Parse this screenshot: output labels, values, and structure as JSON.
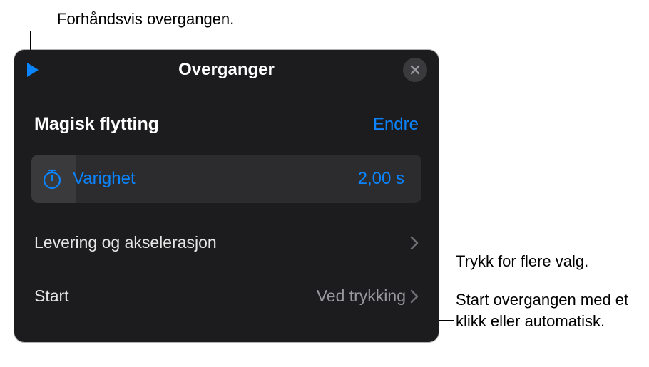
{
  "annotations": {
    "preview": "Forhåndsvis overgangen.",
    "more_options": "Trykk for flere valg.",
    "start_desc": "Start overgangen med et klikk eller automatisk."
  },
  "panel": {
    "title": "Overganger",
    "section_title": "Magisk flytting",
    "change_label": "Endre",
    "duration": {
      "label": "Varighet",
      "value": "2,00 s"
    },
    "delivery": {
      "label": "Levering og akselerasjon"
    },
    "start": {
      "label": "Start",
      "value": "Ved trykking"
    }
  },
  "colors": {
    "accent": "#0a84ff",
    "panel_bg": "#1c1c1e",
    "row_bg": "#2c2c2e",
    "secondary_text": "#98989d"
  }
}
